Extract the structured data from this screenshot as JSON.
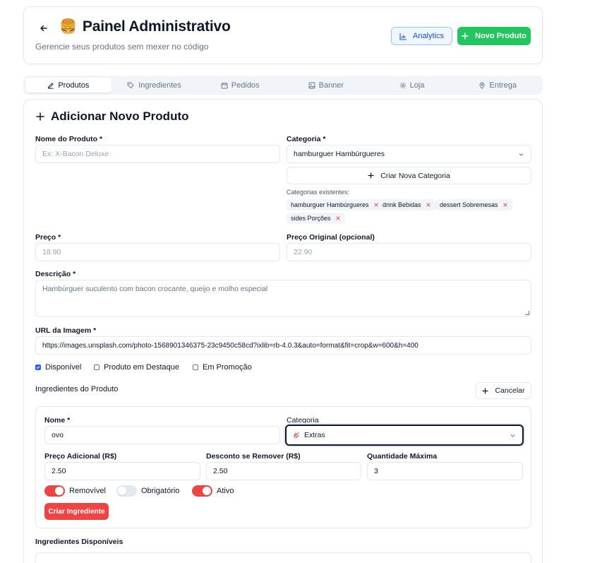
{
  "header": {
    "emoji": "🍔",
    "title": "Painel Administrativo",
    "subtitle": "Gerencie seus produtos sem mexer no código",
    "analytics_label": "Analytics",
    "new_product_label": "Novo Produto"
  },
  "tabs": [
    {
      "label": "Produtos",
      "icon": "pencil-icon",
      "active": true
    },
    {
      "label": "Ingredientes",
      "icon": "tags-icon",
      "active": false
    },
    {
      "label": "Pedidos",
      "icon": "calendar-icon",
      "active": false
    },
    {
      "label": "Banner",
      "icon": "image-icon",
      "active": false
    },
    {
      "label": "Loja",
      "icon": "gear-icon",
      "active": false
    },
    {
      "label": "Entrega",
      "icon": "map-pin-icon",
      "active": false
    }
  ],
  "form": {
    "section_title": "Adicionar Novo Produto",
    "name_label": "Nome do Produto *",
    "name_placeholder": "Ex: X-Bacon Deluxe",
    "category_label": "Categoria *",
    "category_value": "hamburguer Hambúrgueres",
    "create_category_label": "Criar Nova Categoria",
    "existing_categories_label": "Categorias existentes:",
    "existing_categories": [
      "hamburguer Hambúrgueres",
      "drink Bebidas",
      "dessert Sobremesas",
      "sides Porções"
    ],
    "price_label": "Preço *",
    "price_placeholder": "18.90",
    "original_price_label": "Preço Original (opcional)",
    "original_price_placeholder": "22.90",
    "description_label": "Descrição *",
    "description_placeholder": "Hambúrguer suculento com bacon crocante, queijo e molho especial",
    "image_url_label": "URL da Imagem *",
    "image_url_value": "https://images.unsplash.com/photo-1568901346375-23c9450c58cd?ixlib=rb-4.0.3&auto=format&fit=crop&w=600&h=400",
    "checkboxes": [
      {
        "label": "Disponível",
        "checked": true
      },
      {
        "label": "Produto em Destaque",
        "checked": false
      },
      {
        "label": "Em Promoção",
        "checked": false
      }
    ],
    "ingredients_title": "Ingredientes do Produto",
    "cancel_label": "Cancelar",
    "available_ingredients_label": "Ingredientes Disponíveis"
  },
  "ingredient_form": {
    "name_label": "Nome *",
    "name_value": "ovo",
    "category_label": "Categoria",
    "category_value": "Extras",
    "additional_price_label": "Preço Adicional (R$)",
    "additional_price_value": "2.50",
    "discount_label": "Desconto se Remover (R$)",
    "discount_value": "2.50",
    "max_qty_label": "Quantidade Máxima",
    "max_qty_value": "3",
    "toggles": [
      {
        "label": "Removível",
        "on": true
      },
      {
        "label": "Obrigatório",
        "on": false
      },
      {
        "label": "Ativo",
        "on": true
      }
    ],
    "create_label": "Criar Ingrediente"
  },
  "colors": {
    "accent_green": "#22c55e",
    "accent_red": "#ef4444",
    "analytics_blue": "#1d4ed8"
  }
}
